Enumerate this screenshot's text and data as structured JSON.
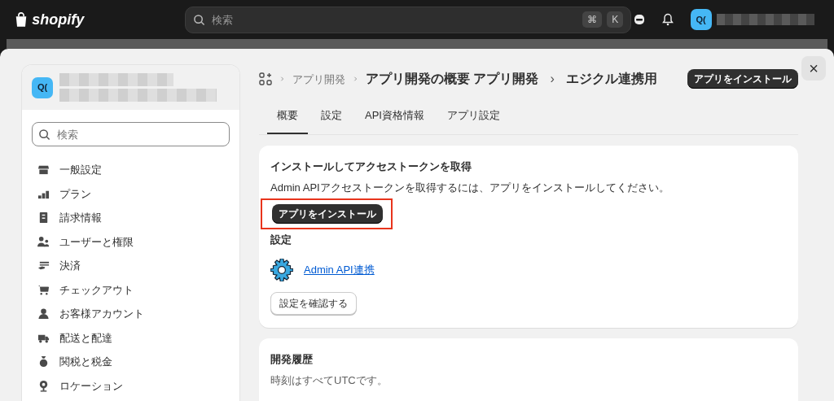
{
  "topbar": {
    "logo": "shopify",
    "search": {
      "placeholder": "検索",
      "shortcut_keys": [
        "⌘",
        "K"
      ]
    },
    "avatar": "Q("
  },
  "sidebar": {
    "avatar": "Q(",
    "search": {
      "placeholder": "検索"
    },
    "items": [
      {
        "label": "一般設定"
      },
      {
        "label": "プラン"
      },
      {
        "label": "請求情報"
      },
      {
        "label": "ユーザーと権限"
      },
      {
        "label": "決済"
      },
      {
        "label": "チェックアウト"
      },
      {
        "label": "お客様アカウント"
      },
      {
        "label": "配送と配達"
      },
      {
        "label": "関税と税金"
      },
      {
        "label": "ロケーション"
      }
    ]
  },
  "header": {
    "breadcrumbs": [
      "アプリ開発"
    ],
    "title": "アプリ開発の概要 アプリ開発",
    "separator": "›",
    "subtitle": "エジクル連携用",
    "action": "アプリをインストール"
  },
  "tabs": [
    {
      "label": "概要",
      "selected": true
    },
    {
      "label": "設定",
      "selected": false
    },
    {
      "label": "API資格情報",
      "selected": false
    },
    {
      "label": "アプリ設定",
      "selected": false
    }
  ],
  "install_card": {
    "title": "インストールしてアクセストークンを取得",
    "description": "Admin APIアクセストークンを取得するには、アプリをインストールしてください。",
    "button": "アプリをインストール",
    "highlighted": true,
    "settings_heading": "設定",
    "link": "Admin API連携",
    "secondary_button": "設定を確認する"
  },
  "history_card": {
    "title": "開発履歴",
    "note": "時刻はすべてUTCです。"
  },
  "close": "×"
}
